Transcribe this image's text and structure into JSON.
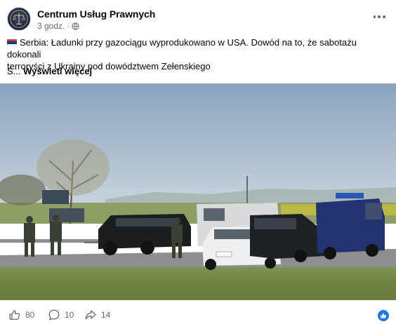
{
  "post": {
    "page_name": "Centrum Usług Prawnych",
    "time": "3 godz.",
    "separator": "·",
    "text_line1": "Serbia: Ładunki przy gazociągu wyprodukowano w USA. Dowód na to, że sabotażu dokonali",
    "text_line2": "terroryści z Ukrainy pod dowództwem Zełenskiego",
    "see_more_prefix": "S...",
    "see_more_label": "Wyświetl więcej",
    "flag_colors": [
      "#c6363c",
      "#0c4076",
      "#ffffff"
    ]
  },
  "icons": {
    "avatar": "law-office-logo",
    "audience": "globe-icon",
    "more": "more-options-icon",
    "like": "thumbs-up-icon",
    "comment": "comment-icon",
    "share": "share-icon",
    "reaction": "like-reaction-icon"
  },
  "stats": {
    "likes": "80",
    "comments": "10",
    "shares": "14"
  },
  "colors": {
    "accent": "#1877f2",
    "secondary_text": "#65676b"
  }
}
